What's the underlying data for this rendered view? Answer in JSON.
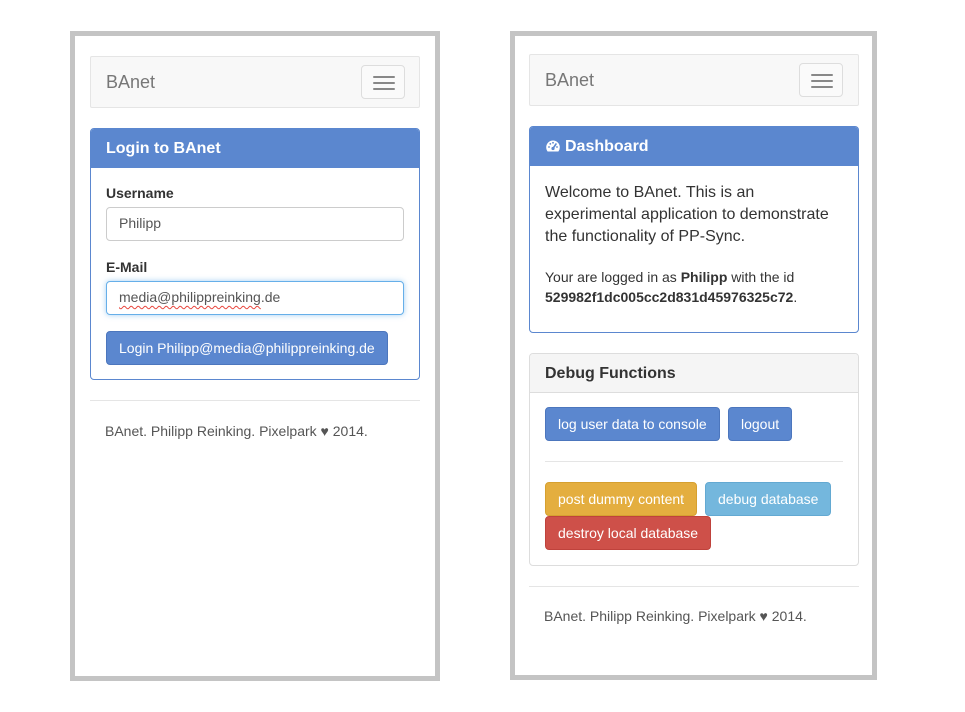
{
  "left_screen": {
    "navbar": {
      "brand": "BAnet",
      "toggle_icon": "hamburger-icon"
    },
    "login_panel": {
      "title": "Login to BAnet",
      "username_label": "Username",
      "username_value": "Philipp",
      "email_label": "E-Mail",
      "email_value_misspelled": "media@philippreinking",
      "email_value_rest": ".de",
      "login_button": "Login Philipp@media@philippreinking.de"
    },
    "footer": "BAnet. Philipp Reinking. Pixelpark ♥ 2014."
  },
  "right_screen": {
    "navbar": {
      "brand": "BAnet",
      "toggle_icon": "hamburger-icon"
    },
    "dashboard_panel": {
      "icon": "dashboard-icon",
      "title": "Dashboard",
      "welcome_text": "Welcome to BAnet. This is an experimental application to demonstrate the functionality of PP-Sync.",
      "logged_in_prefix": "Your are logged in as",
      "user_name": "Philipp",
      "id_prefix": "with the id",
      "user_id": "529982f1dc005cc2d831d45976325c72",
      "period": "."
    },
    "debug_panel": {
      "title": "Debug Functions",
      "buttons": {
        "log_user_data": "log user data to console",
        "logout": "logout",
        "post_dummy": "post dummy content",
        "debug_database": "debug database",
        "destroy_local": "destroy local database"
      }
    },
    "footer": "BAnet. Philipp Reinking. Pixelpark ♥ 2014."
  },
  "colors": {
    "primary": "#5b87cf",
    "warning": "#e4ae3f",
    "info": "#74b7dd",
    "danger": "#ce5049",
    "frame": "#c4c4c4"
  }
}
